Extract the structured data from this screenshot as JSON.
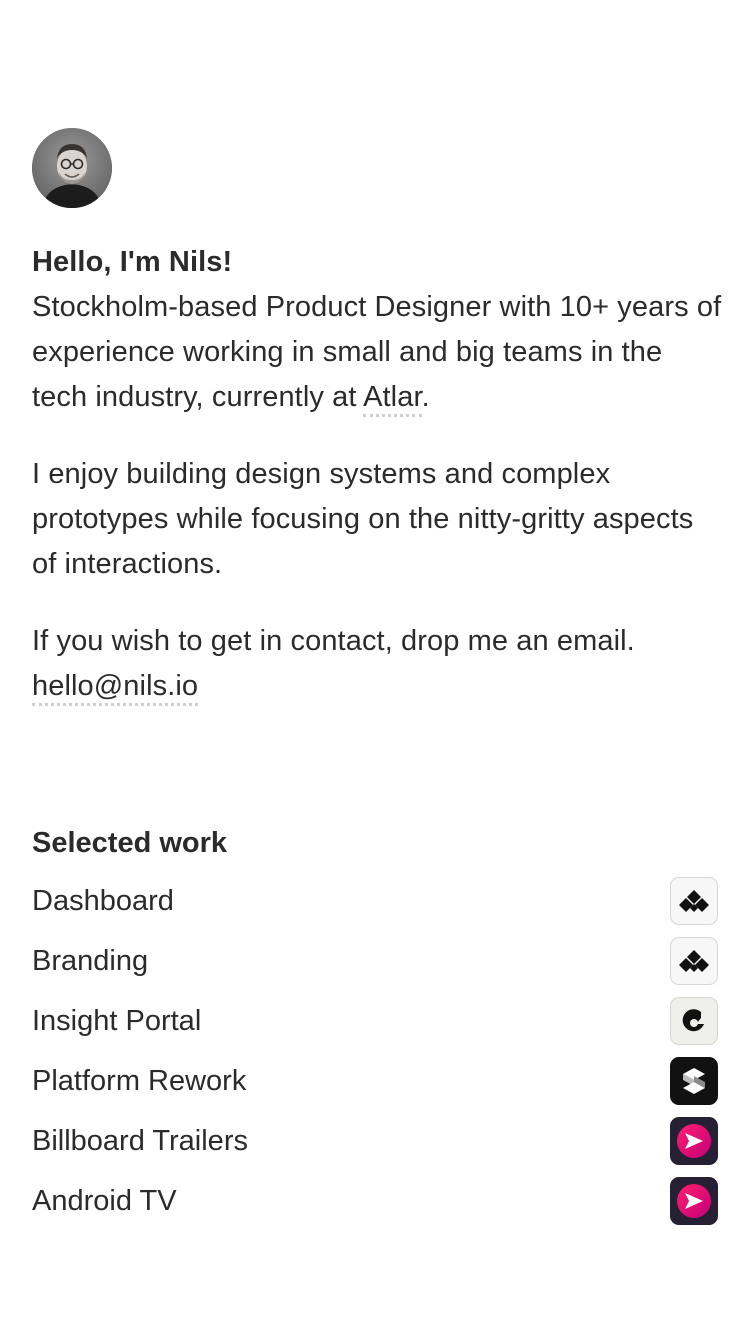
{
  "profile": {
    "greeting": "Hello, I'm Nils!",
    "bio_prefix": "Stockholm-based Product Designer with 10+ years of experience working in small and big teams in the tech industry, currently at ",
    "company_link": "Atlar",
    "bio_suffix": ".",
    "paragraph_2": "I enjoy building design systems and complex prototypes while focusing on the nitty-gritty aspects of interactions.",
    "contact_text": "If you wish to get in contact, drop me an email.",
    "email": "hello@nils.io"
  },
  "work": {
    "heading": "Selected work",
    "items": [
      {
        "label": "Dashboard",
        "icon": "atlar-logo-icon"
      },
      {
        "label": "Branding",
        "icon": "atlar-logo-icon"
      },
      {
        "label": "Insight Portal",
        "icon": "portal-logo-icon"
      },
      {
        "label": "Platform Rework",
        "icon": "platform-logo-icon"
      },
      {
        "label": "Billboard Trailers",
        "icon": "viaplay-logo-icon"
      },
      {
        "label": "Android TV",
        "icon": "viaplay-logo-icon"
      }
    ]
  },
  "colors": {
    "text": "#2b2b2b",
    "link_underline": "#cfcfcf",
    "viaplay_gradient_start": "#ff1e6e",
    "viaplay_gradient_end": "#c4007a"
  }
}
